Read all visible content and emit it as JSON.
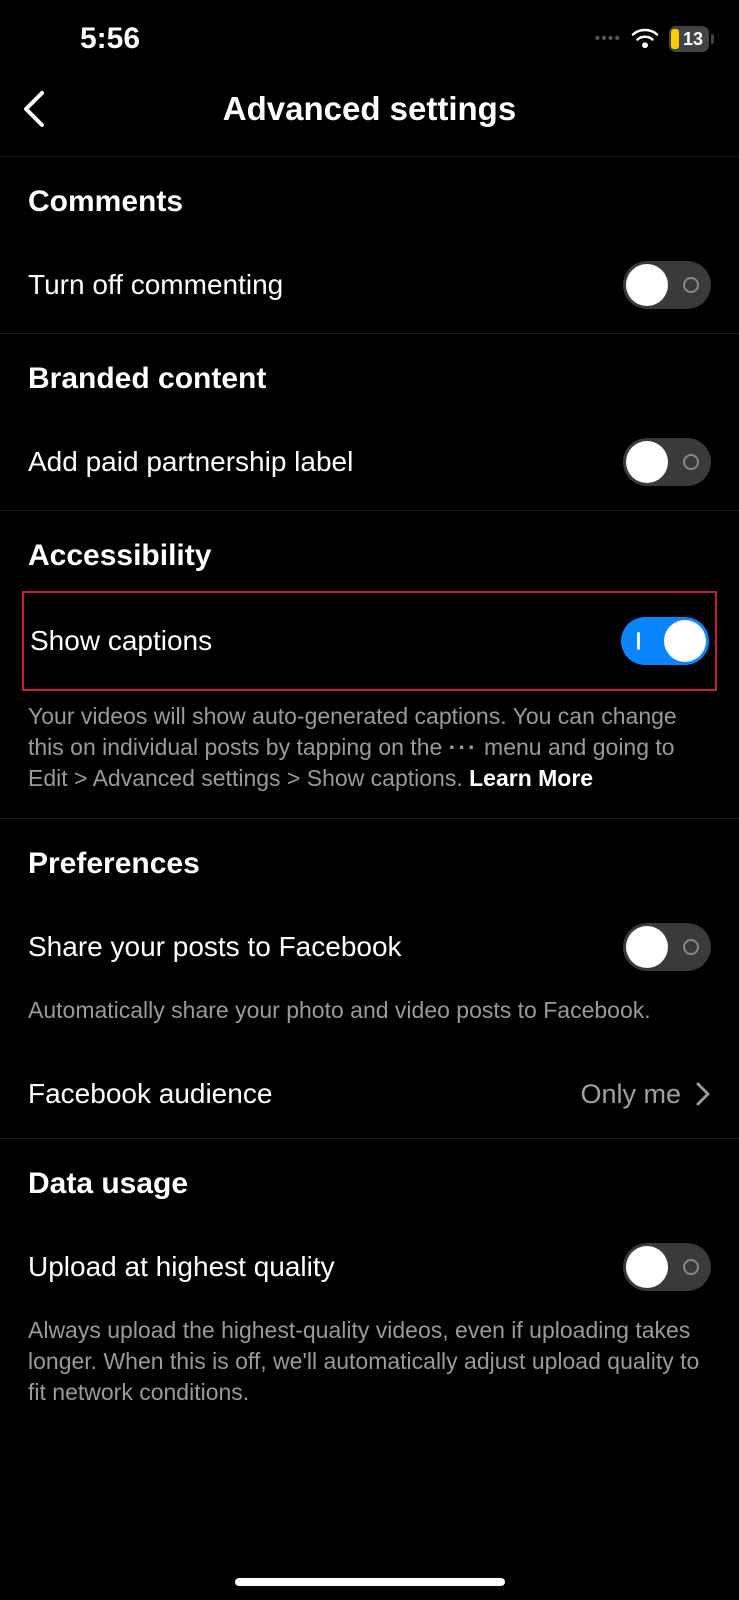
{
  "status": {
    "time": "5:56",
    "battery_percent": "13"
  },
  "header": {
    "title": "Advanced settings"
  },
  "sections": {
    "comments": {
      "title": "Comments",
      "toggle_label": "Turn off commenting",
      "toggle_on": false
    },
    "branded": {
      "title": "Branded content",
      "toggle_label": "Add paid partnership label",
      "toggle_on": false
    },
    "accessibility": {
      "title": "Accessibility",
      "toggle_label": "Show captions",
      "toggle_on": true,
      "description_pre": "Your videos will show auto-generated captions. You can change this on individual posts by tapping on the ",
      "description_dots": "···",
      "description_mid": " menu and going to Edit > Advanced settings > Show captions. ",
      "learn_more": "Learn More"
    },
    "preferences": {
      "title": "Preferences",
      "share_label": "Share your posts to Facebook",
      "share_on": false,
      "share_description": "Automatically share your photo and video posts to Facebook.",
      "audience_label": "Facebook audience",
      "audience_value": "Only me"
    },
    "data_usage": {
      "title": "Data usage",
      "upload_label": "Upload at highest quality",
      "upload_on": false,
      "upload_description": "Always upload the highest-quality videos, even if uploading takes longer. When this is off, we'll automatically adjust upload quality to fit network conditions."
    }
  }
}
